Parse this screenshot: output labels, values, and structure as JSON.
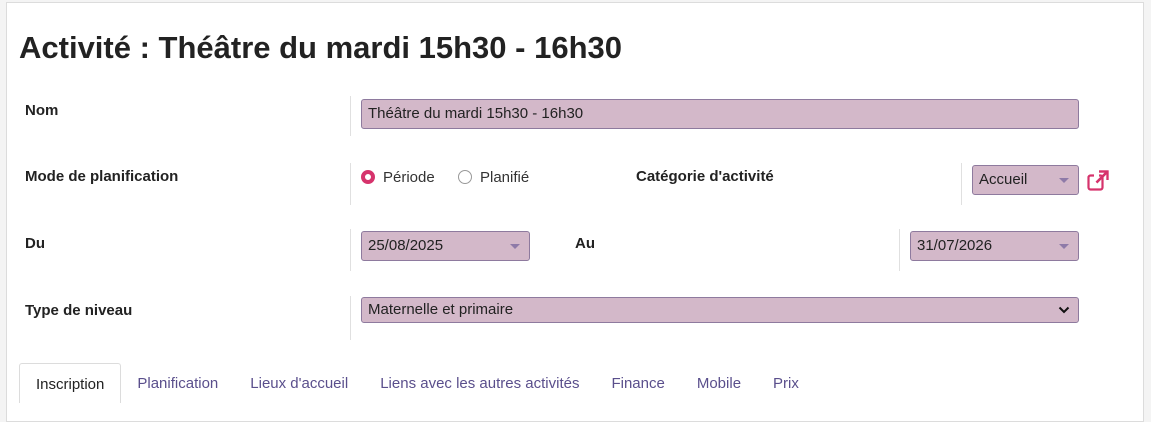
{
  "title": "Activité : Théâtre du mardi 15h30 - 16h30",
  "form": {
    "nom_label": "Nom",
    "nom_value": "Théâtre du mardi 15h30 - 16h30",
    "mode_label": "Mode de planification",
    "mode_options": [
      "Période",
      "Planifié"
    ],
    "mode_selected": "Période",
    "categorie_label": "Catégorie d'activité",
    "categorie_value": "Accueil",
    "du_label": "Du",
    "du_value": "25/08/2025",
    "au_label": "Au",
    "au_value": "31/07/2026",
    "niveau_label": "Type de niveau",
    "niveau_value": "Maternelle et primaire"
  },
  "tabs": [
    "Inscription",
    "Planification",
    "Lieux d'accueil",
    "Liens avec les autres activités",
    "Finance",
    "Mobile",
    "Prix"
  ],
  "active_tab": "Inscription",
  "colors": {
    "field_bg": "#d3b8c9",
    "accent": "#d6336c",
    "tab_link": "#5a4f8c"
  }
}
